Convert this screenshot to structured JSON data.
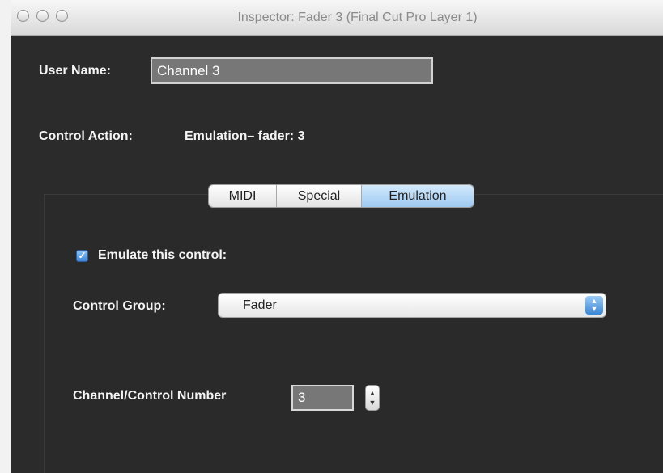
{
  "window": {
    "title": "Inspector: Fader 3 (Final Cut Pro Layer 1)"
  },
  "user_name": {
    "label": "User Name:",
    "value": "Channel 3"
  },
  "control_action": {
    "label": "Control Action:",
    "value": "Emulation– fader: 3"
  },
  "tabs": [
    {
      "label": "MIDI",
      "active": false
    },
    {
      "label": "Special",
      "active": false
    },
    {
      "label": "Emulation",
      "active": true
    }
  ],
  "emulation": {
    "checkbox_label": "Emulate this control:",
    "checked": true,
    "control_group_label": "Control Group:",
    "control_group_value": "Fader",
    "number_label": "Channel/Control Number",
    "number_value": "3"
  },
  "colors": {
    "window_bg": "#2b2b2b",
    "active_tab": "#9ecaf2",
    "accent": "#3a86d4"
  }
}
